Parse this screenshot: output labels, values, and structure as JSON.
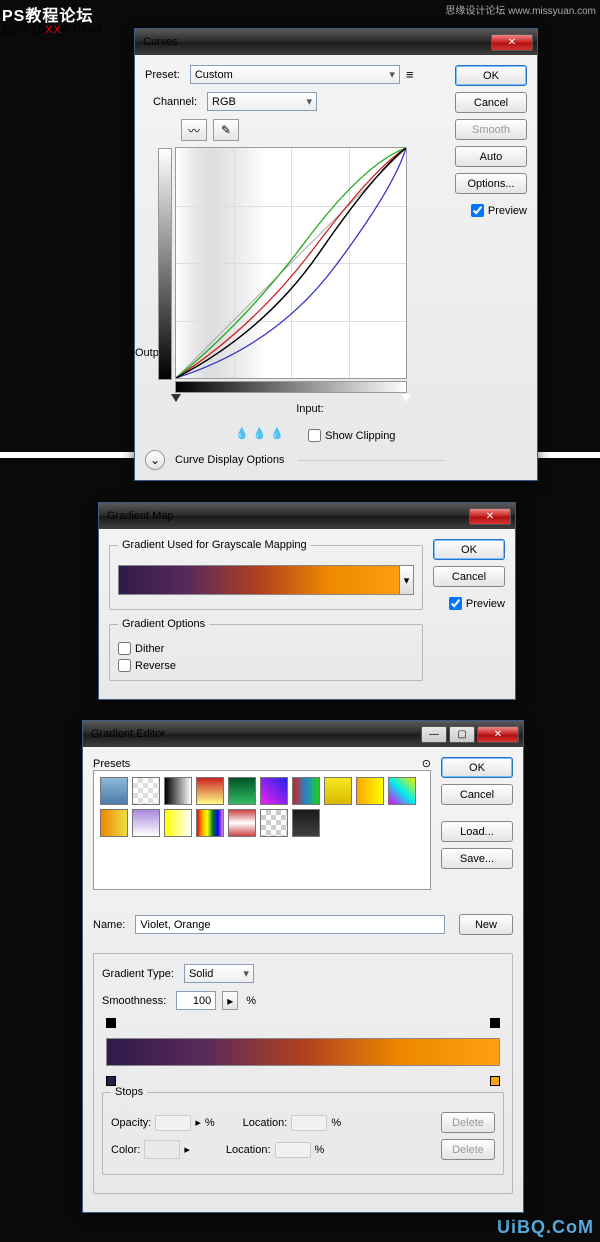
{
  "watermarks": {
    "top": "PS教程论坛",
    "bbs": "BBS.16",
    "bbs2": "8.COM",
    "xx": "XX",
    "tr": "思缘设计论坛 www.missyuan.com",
    "br": "UiBQ.CoM"
  },
  "curves": {
    "title": "Curves",
    "preset_label": "Preset:",
    "preset_value": "Custom",
    "channel_label": "Channel:",
    "channel_value": "RGB",
    "output_label": "Output:",
    "input_label": "Input:",
    "show_clipping": "Show Clipping",
    "curve_display": "Curve Display Options",
    "ok": "OK",
    "cancel": "Cancel",
    "smooth": "Smooth",
    "auto": "Auto",
    "options": "Options...",
    "preview": "Preview"
  },
  "gmap": {
    "title": "Gradient Map",
    "legend": "Gradient Used for Grayscale Mapping",
    "options_legend": "Gradient Options",
    "dither": "Dither",
    "reverse": "Reverse",
    "ok": "OK",
    "cancel": "Cancel",
    "preview": "Preview"
  },
  "gedit": {
    "title": "Gradient Editor",
    "presets_label": "Presets",
    "ok": "OK",
    "cancel": "Cancel",
    "load": "Load...",
    "save": "Save...",
    "new": "New",
    "name_label": "Name:",
    "name_value": "Violet, Orange",
    "gtype_label": "Gradient Type:",
    "gtype_value": "Solid",
    "smooth_label": "Smoothness:",
    "smooth_value": "100",
    "pct": "%",
    "stops_legend": "Stops",
    "opacity_label": "Opacity:",
    "location_label": "Location:",
    "color_label": "Color:",
    "delete": "Delete",
    "swatches": [
      "linear-gradient(#8cb8d8,#4a7aa8)",
      "repeating-conic-gradient(#ddd 0 25%,#fff 0 50%) 0 0/10px 10px",
      "linear-gradient(to right,#000,#fff)",
      "linear-gradient(#c22,#ff8)",
      "linear-gradient(#052,#3b6)",
      "linear-gradient(45deg,#e2e,#22e)",
      "linear-gradient(to right,#c22,#28c,#2c2)",
      "linear-gradient(#f8e820,#d8b800)",
      "linear-gradient(to right,#ffa500,#ff0)",
      "linear-gradient(45deg,#e0e,#0ee,#ee0)",
      "linear-gradient(to right,#e80,#ed4)",
      "linear-gradient(#a8d,#fff)",
      "linear-gradient(to right,#ff0,#fff)",
      "linear-gradient(to right,red,orange,yellow,green,blue,violet)",
      "linear-gradient(#c44,#fff,#c44)",
      "repeating-conic-gradient(#ccc 0 25%,#fff 0 50%) 0 0/10px 10px",
      "linear-gradient(#1a1a1a,#404040)"
    ]
  }
}
